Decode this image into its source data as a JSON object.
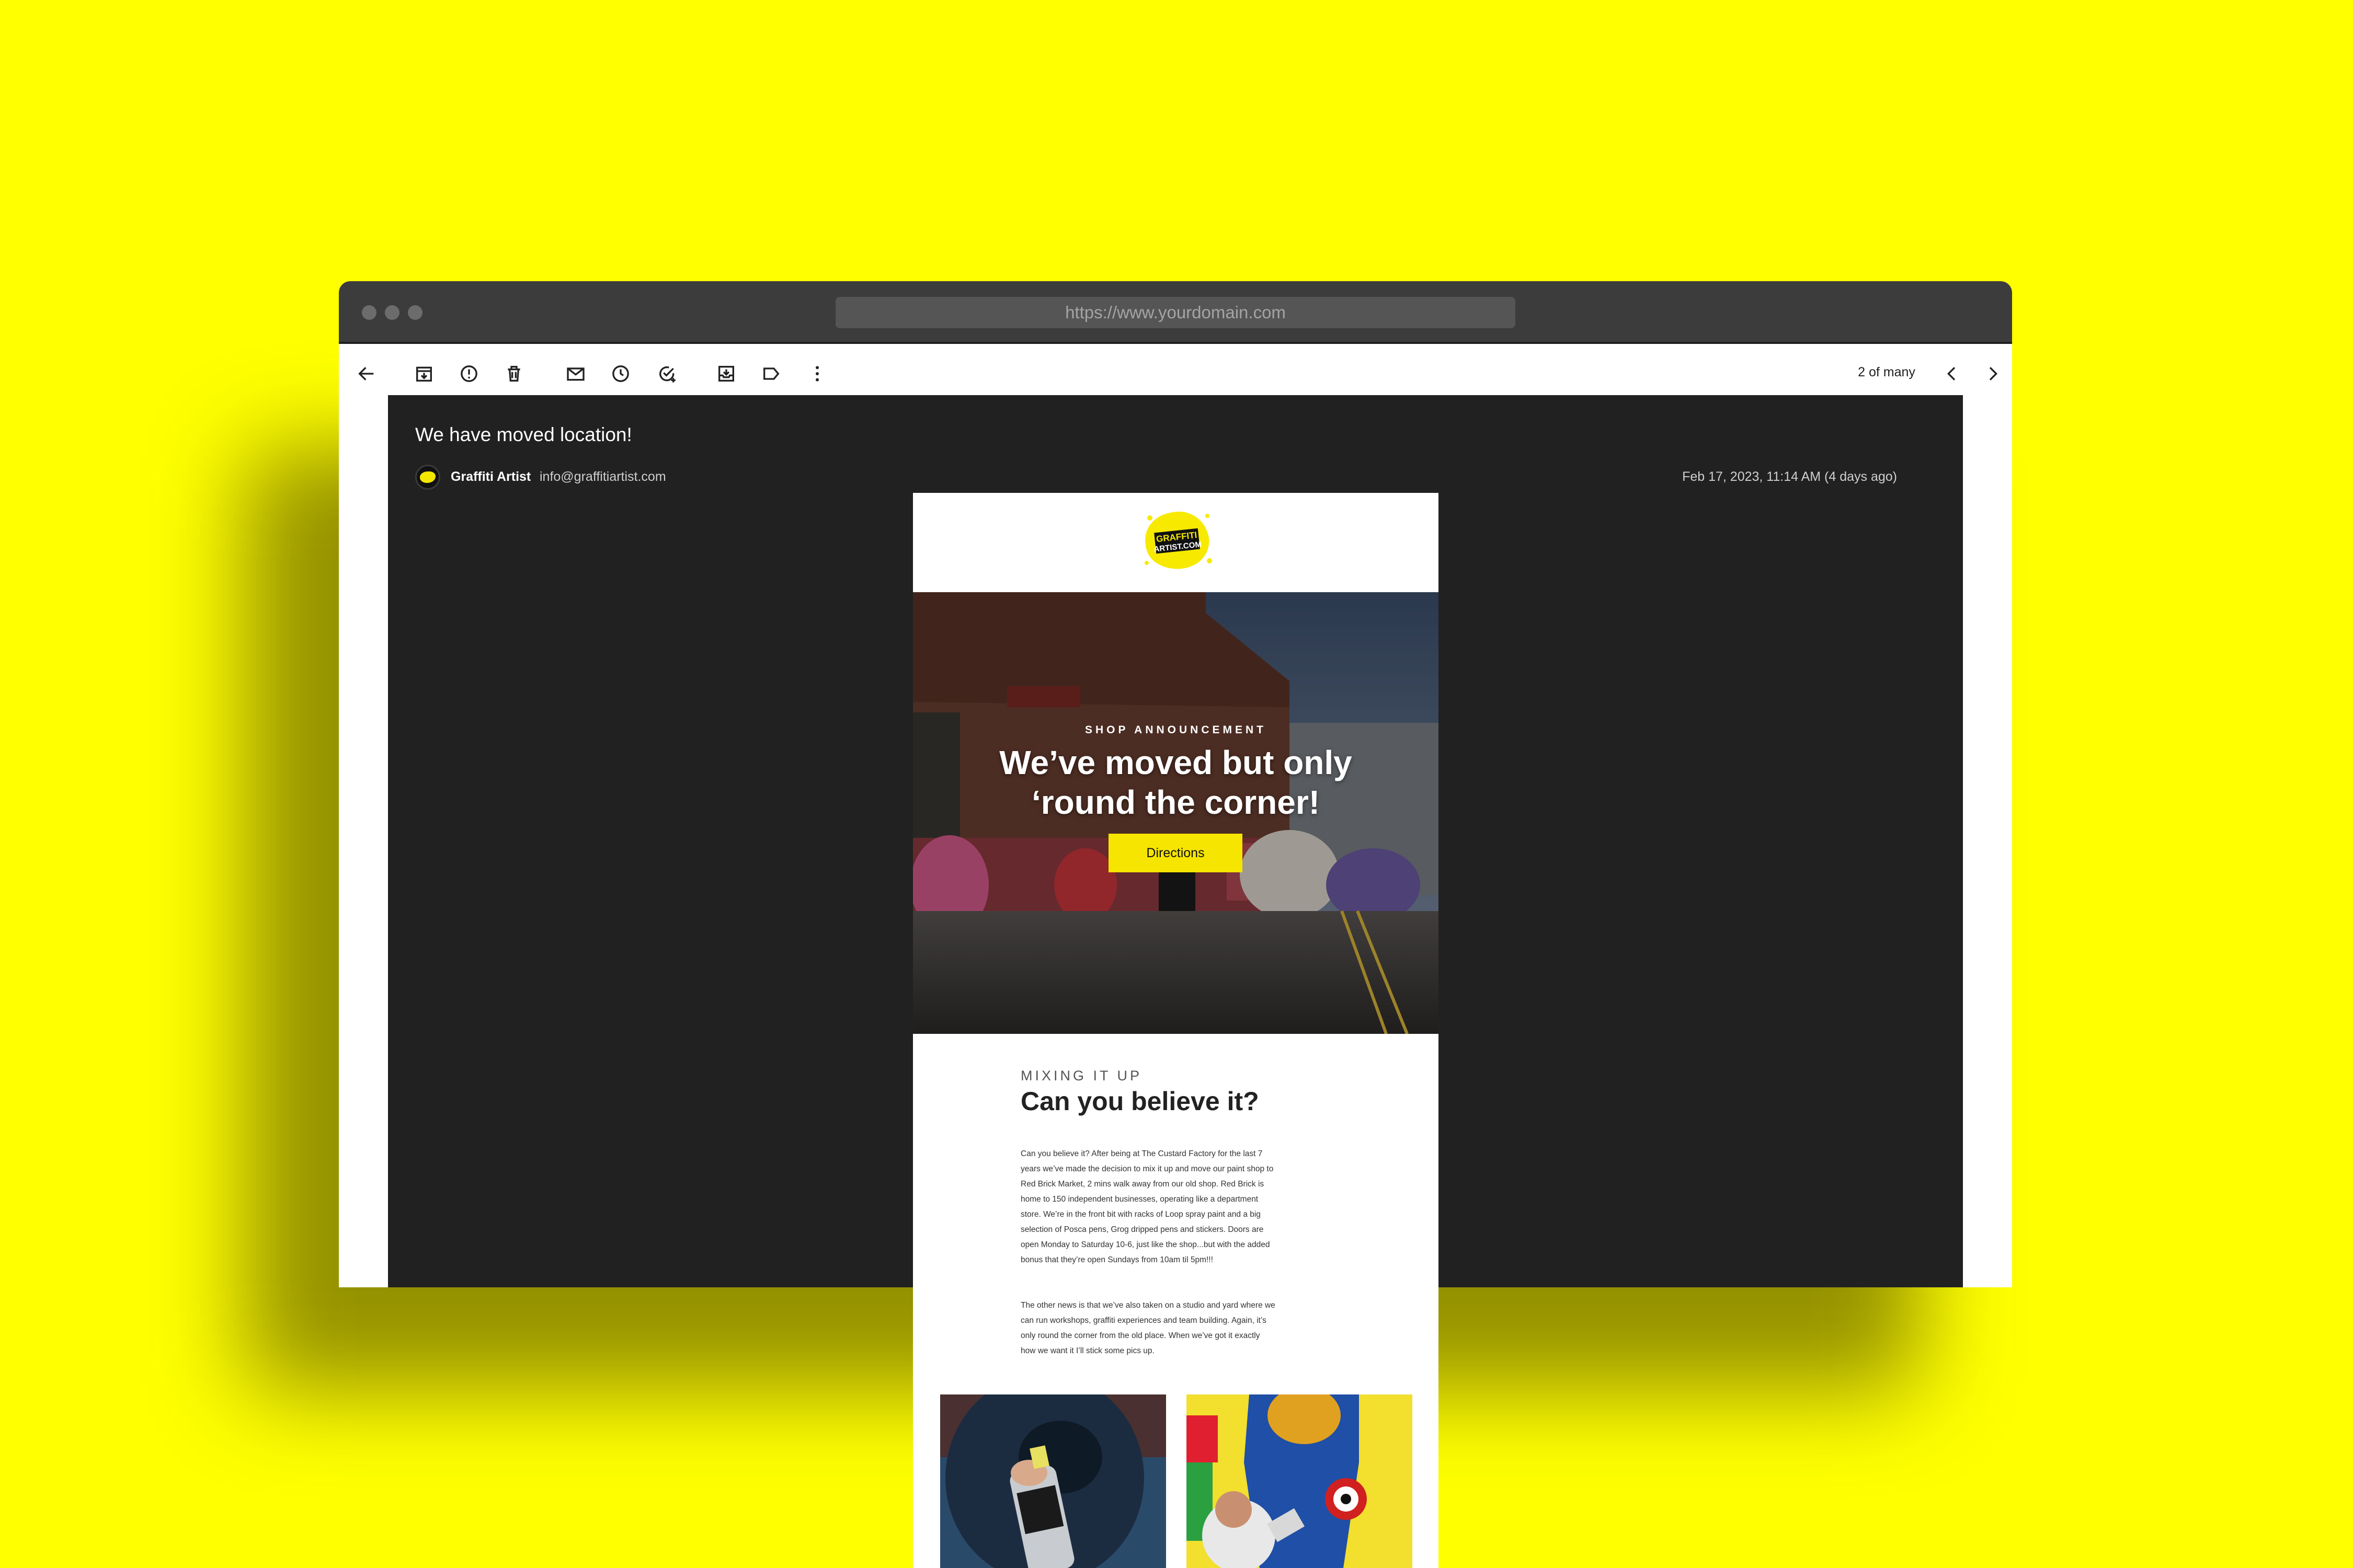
{
  "browser": {
    "url": "https://www.yourdomain.com"
  },
  "toolbar": {
    "icons": [
      "back-arrow-icon",
      "archive-icon",
      "report-spam-icon",
      "delete-icon",
      "mark-unread-icon",
      "snooze-icon",
      "add-task-icon",
      "move-to-icon",
      "label-icon",
      "more-options-icon"
    ],
    "pager": "2 of many"
  },
  "email": {
    "subject": "We have moved location!",
    "sender_name": "Graffiti Artist",
    "sender_email": "info@graffitiartist.com",
    "date": "Feb 17, 2023, 11:14 AM (4 days ago)"
  },
  "newsletter": {
    "logo_text": "GRAFFITI ARTIST.COM",
    "hero": {
      "kicker": "SHOP ANNOUNCEMENT",
      "title_line1": "We’ve moved but only",
      "title_line2": "‘round the corner!",
      "button": "Directions"
    },
    "section": {
      "kicker": "MIXING IT UP",
      "title": "Can you believe it?",
      "paragraph1_lines": [
        "Can you believe it? After being at The Custard Factory for the last 7",
        "years we’ve made the decision to mix it up and move our paint shop to",
        "Red Brick Market, 2 mins walk away from our old shop. Red Brick is",
        "home to 150 independent businesses, operating like a department",
        "store. We’re in the front bit with racks of Loop spray paint and a big",
        "selection of Posca pens, Grog dripped pens and stickers. Doors are",
        "open Monday to Saturday 10-6, just like the shop...but with the added",
        "bonus that they’re open Sundays from 10am til 5pm!!!"
      ],
      "paragraph2_lines": [
        "The other news is that we’ve also taken on a studio and yard where we",
        "can run workshops, graffiti experiences and team building. Again, it’s",
        "only round the corner from the old place. When we’ve got it exactly",
        "how we want it I’ll stick some pics up."
      ]
    }
  },
  "colors": {
    "background": "#ffff00",
    "accent": "#f5e500",
    "mail_bg": "#212121"
  }
}
